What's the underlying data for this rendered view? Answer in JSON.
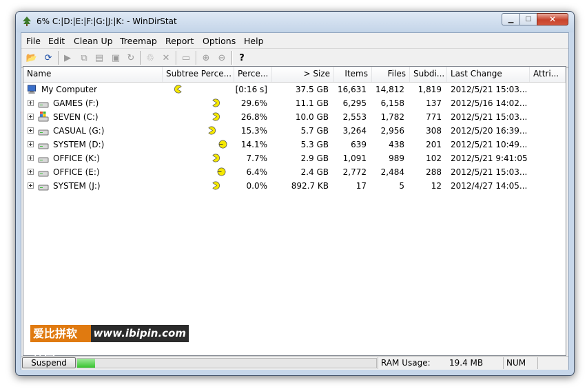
{
  "window": {
    "title": "6% C:|D:|E:|F:|G:|J:|K: - WinDirStat",
    "icon": "tree-icon"
  },
  "menubar": {
    "items": [
      "File",
      "Edit",
      "Clean Up",
      "Treemap",
      "Report",
      "Options",
      "Help"
    ]
  },
  "toolbar": {
    "icons": [
      "open-icon",
      "refresh-icon",
      "play-icon",
      "copy-path-icon",
      "explorer-icon",
      "command-prompt-icon",
      "refresh-selected-icon",
      "recycle-icon",
      "delete-icon",
      "properties-icon",
      "zoom-in-icon",
      "zoom-out-icon",
      "help-icon"
    ]
  },
  "columns": [
    "Name",
    "Subtree Perce...",
    "Perce...",
    "> Size",
    "Items",
    "Files",
    "Subdi...",
    "Last Change",
    "Attri..."
  ],
  "rows": [
    {
      "name": "My Computer",
      "percent": "[0:16 s]",
      "size": "37.5 GB",
      "items": "16,631",
      "files": "14,812",
      "subdirs": "1,819",
      "last_change": "2012/5/21  15:03...",
      "icon": "computer-icon",
      "pacman": "pacman-icon"
    },
    {
      "name": "GAMES (F:)",
      "percent": "29.6%",
      "size": "11.1 GB",
      "items": "6,295",
      "files": "6,158",
      "subdirs": "137",
      "last_change": "2012/5/16  14:02...",
      "icon": "drive-icon",
      "pacman": "pacman-icon"
    },
    {
      "name": "SEVEN (C:)",
      "percent": "26.8%",
      "size": "10.0 GB",
      "items": "2,553",
      "files": "1,782",
      "subdirs": "771",
      "last_change": "2012/5/21  15:03...",
      "icon": "windows-drive-icon",
      "pacman": "pacman-icon"
    },
    {
      "name": "CASUAL (G:)",
      "percent": "15.3%",
      "size": "5.7 GB",
      "items": "3,264",
      "files": "2,956",
      "subdirs": "308",
      "last_change": "2012/5/20  16:39...",
      "icon": "drive-icon",
      "pacman": "pacman-icon"
    },
    {
      "name": "SYSTEM (D:)",
      "percent": "14.1%",
      "size": "5.3 GB",
      "items": "639",
      "files": "438",
      "subdirs": "201",
      "last_change": "2012/5/21  10:49...",
      "icon": "drive-icon",
      "pacman": "pacman-icon"
    },
    {
      "name": "OFFICE (K:)",
      "percent": "7.7%",
      "size": "2.9 GB",
      "items": "1,091",
      "files": "989",
      "subdirs": "102",
      "last_change": "2012/5/21  9:41:05",
      "icon": "drive-icon",
      "pacman": "pacman-icon"
    },
    {
      "name": "OFFICE (E:)",
      "percent": "6.4%",
      "size": "2.4 GB",
      "items": "2,772",
      "files": "2,484",
      "subdirs": "288",
      "last_change": "2012/5/21  15:03...",
      "icon": "drive-icon",
      "pacman": "pacman-icon"
    },
    {
      "name": "SYSTEM (J:)",
      "percent": "0.0%",
      "size": "892.7 KB",
      "items": "17",
      "files": "5",
      "subdirs": "12",
      "last_change": "2012/4/27  14:05...",
      "icon": "drive-icon",
      "pacman": "pacman-icon"
    }
  ],
  "statusbar": {
    "suspend_label": "Suspend",
    "progress_percent": 6,
    "ram_label": "RAM Usage:",
    "ram_value": "19.4 MB",
    "num_label": "NUM"
  },
  "watermark": {
    "cn_text": "爱比拼软件园",
    "en_text": "www.ibipin.com"
  },
  "colors": {
    "pacman": "#f5e800",
    "progress": "#37c42e",
    "close_button": "#c8442d",
    "watermark_orange": "#e07a10"
  }
}
